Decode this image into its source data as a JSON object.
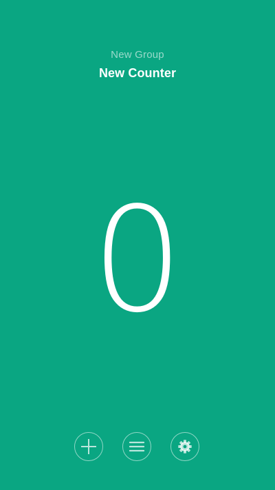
{
  "header": {
    "group_label": "New Group",
    "counter_label": "New Counter"
  },
  "counter": {
    "value": "0"
  },
  "toolbar": {
    "buttons": [
      {
        "icon": "plus-icon",
        "action": "add"
      },
      {
        "icon": "menu-icon",
        "action": "menu"
      },
      {
        "icon": "gear-icon",
        "action": "settings"
      }
    ]
  },
  "colors": {
    "background": "#0aa682",
    "foreground": "#ffffff",
    "muted_text": "rgba(255,255,255,0.58)",
    "button_border": "rgba(255,255,255,0.55)"
  }
}
